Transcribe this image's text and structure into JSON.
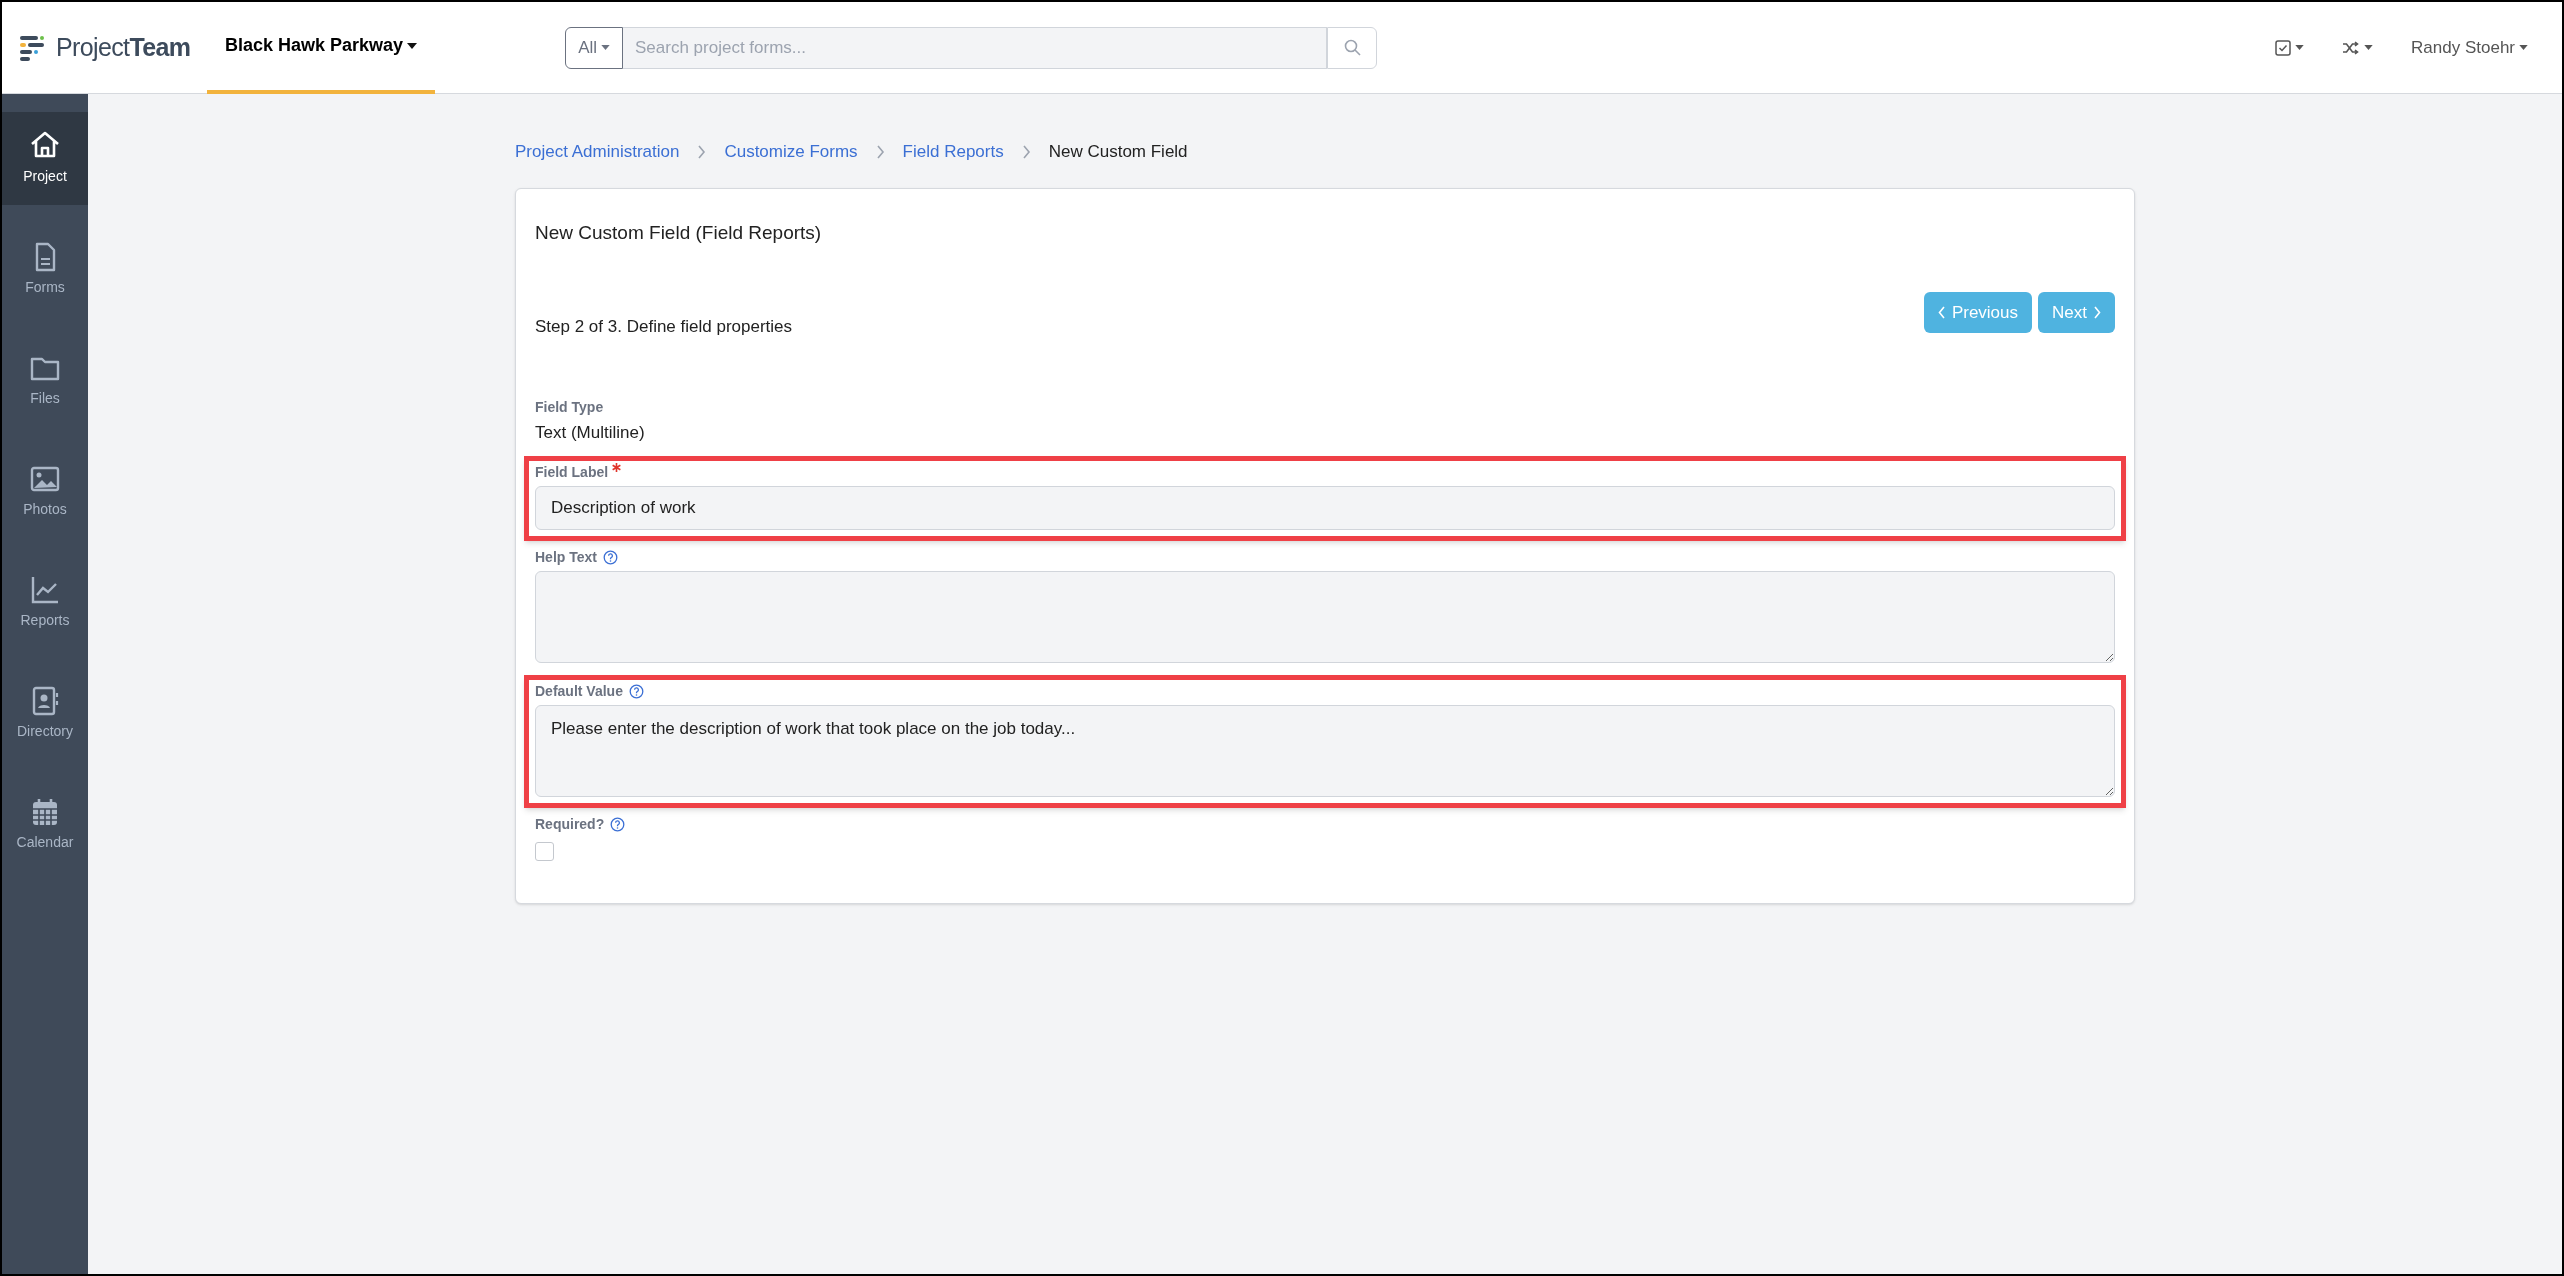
{
  "header": {
    "logo": "Project**Team**",
    "project": "Black Hawk Parkway",
    "search_scope": "All",
    "search": {
      "placeholder": "Search project forms..."
    },
    "user": "Randy Stoehr"
  },
  "sidebar": {
    "items": [
      {
        "label": "Project",
        "kind": "home",
        "selected": true
      },
      {
        "label": "Forms",
        "kind": "document",
        "selected": false
      },
      {
        "label": "Files",
        "kind": "folder",
        "selected": false
      },
      {
        "label": "Photos",
        "kind": "image",
        "selected": false
      },
      {
        "label": "Reports",
        "kind": "chart",
        "selected": false
      },
      {
        "label": "Directory",
        "kind": "contact",
        "selected": false
      },
      {
        "label": "Calendar",
        "kind": "calendar",
        "selected": false
      }
    ]
  },
  "breadcrumbs": [
    {
      "label": "Project Administration",
      "link": true
    },
    {
      "label": "Customize Forms",
      "link": true
    },
    {
      "label": "Field Reports",
      "link": true
    },
    {
      "label": "New Custom Field",
      "link": false
    }
  ],
  "card": {
    "title": "New Custom Field (Field Reports)",
    "step": "Step 2 of 3. Define field properties",
    "buttons": [
      {
        "label": "Previous",
        "kind": "prev"
      },
      {
        "label": "Next",
        "kind": "next"
      }
    ],
    "field_type": {
      "label": "Field Type",
      "value": "Text (Multiline)"
    },
    "fields": [
      {
        "kind": "input",
        "label": "Field Label",
        "required": true,
        "help": false,
        "value": "Description of work",
        "highlighted": true
      },
      {
        "kind": "textarea",
        "label": "Help Text",
        "required": false,
        "help": true,
        "highlighted": false
      },
      {
        "kind": "textarea",
        "label": "Default Value",
        "required": false,
        "help": true,
        "value": "Please enter the description of work that took place on the job today...",
        "highlighted": true
      },
      {
        "kind": "checkbox",
        "label": "Required?",
        "required": false,
        "help": true,
        "checked": false,
        "highlighted": false
      }
    ]
  }
}
